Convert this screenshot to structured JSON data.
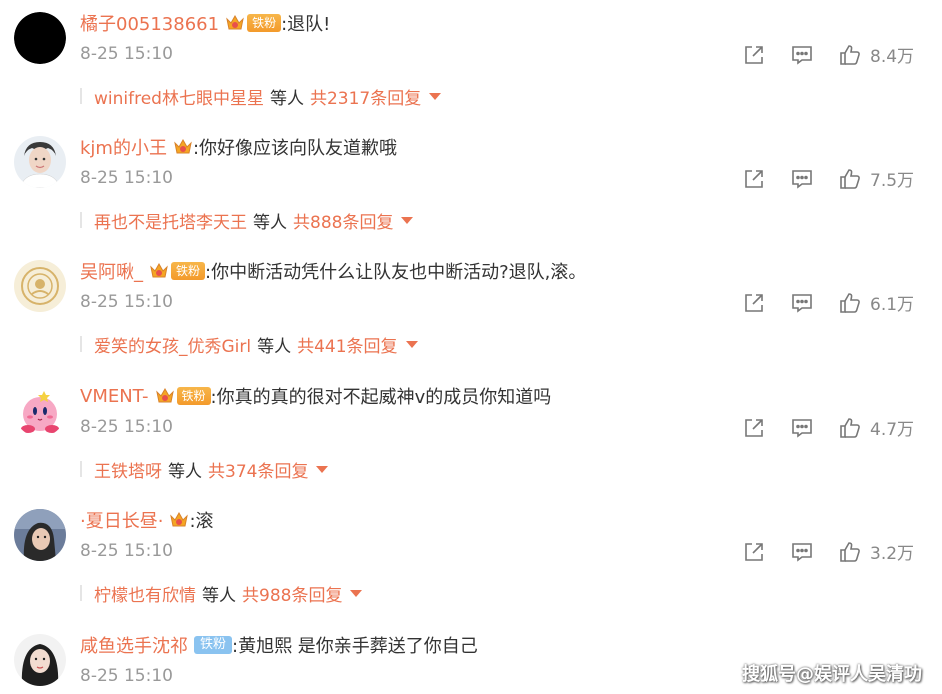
{
  "comments": [
    {
      "username": "橘子005138661",
      "badge": "铁粉",
      "has_crown": true,
      "text": ":退队!",
      "time": "8-25 15:10",
      "likes": "8.4万",
      "reply_user": "winifred林七眼中星星",
      "reply_mid": "等人",
      "reply_count": "共2317条回复",
      "avatar": "black-circle"
    },
    {
      "username": "kjm的小王",
      "badge": "",
      "has_crown": true,
      "text": ":你好像应该向队友道歉哦",
      "time": "8-25 15:10",
      "likes": "7.5万",
      "reply_user": "再也不是托塔李天王",
      "reply_mid": "等人",
      "reply_count": "共888条回复",
      "avatar": "person"
    },
    {
      "username": "吴阿啾_",
      "badge": "铁粉",
      "has_crown": true,
      "text": ":你中断活动凭什么让队友也中断活动?退队,滚。",
      "time": "8-25 15:10",
      "likes": "6.1万",
      "reply_user": "爱笑的女孩_优秀Girl",
      "reply_mid": "等人",
      "reply_count": "共441条回复",
      "avatar": "emblem"
    },
    {
      "username": "VMENT-",
      "badge": "铁粉",
      "has_crown": true,
      "text": ":你真的真的很对不起威神v的成员你知道吗",
      "time": "8-25 15:10",
      "likes": "4.7万",
      "reply_user": "王铁塔呀",
      "reply_mid": "等人",
      "reply_count": "共374条回复",
      "avatar": "kirby"
    },
    {
      "username": "·夏日长昼·",
      "badge": "",
      "has_crown": true,
      "text": ":滚",
      "time": "8-25 15:10",
      "likes": "3.2万",
      "reply_user": "柠檬也有欣情",
      "reply_mid": "等人",
      "reply_count": "共988条回复",
      "avatar": "photo"
    },
    {
      "username": "咸鱼选手沈祁",
      "badge": "铁粉",
      "badge_style": "blue",
      "has_crown": false,
      "text": ":黄旭熙 是你亲手葬送了你自己",
      "time": "8-25 15:10",
      "likes": "",
      "reply_user": "",
      "reply_mid": "",
      "reply_count": "",
      "avatar": "woman"
    }
  ],
  "watermark": "搜狐号@娱评人吴清功",
  "colors": {
    "username": "#eb7350",
    "meta": "#999999",
    "badge_gold": "#f39a2b",
    "badge_blue": "#8ac3f0"
  },
  "icons": [
    "share-icon",
    "comment-icon",
    "like-icon",
    "crown-icon"
  ]
}
